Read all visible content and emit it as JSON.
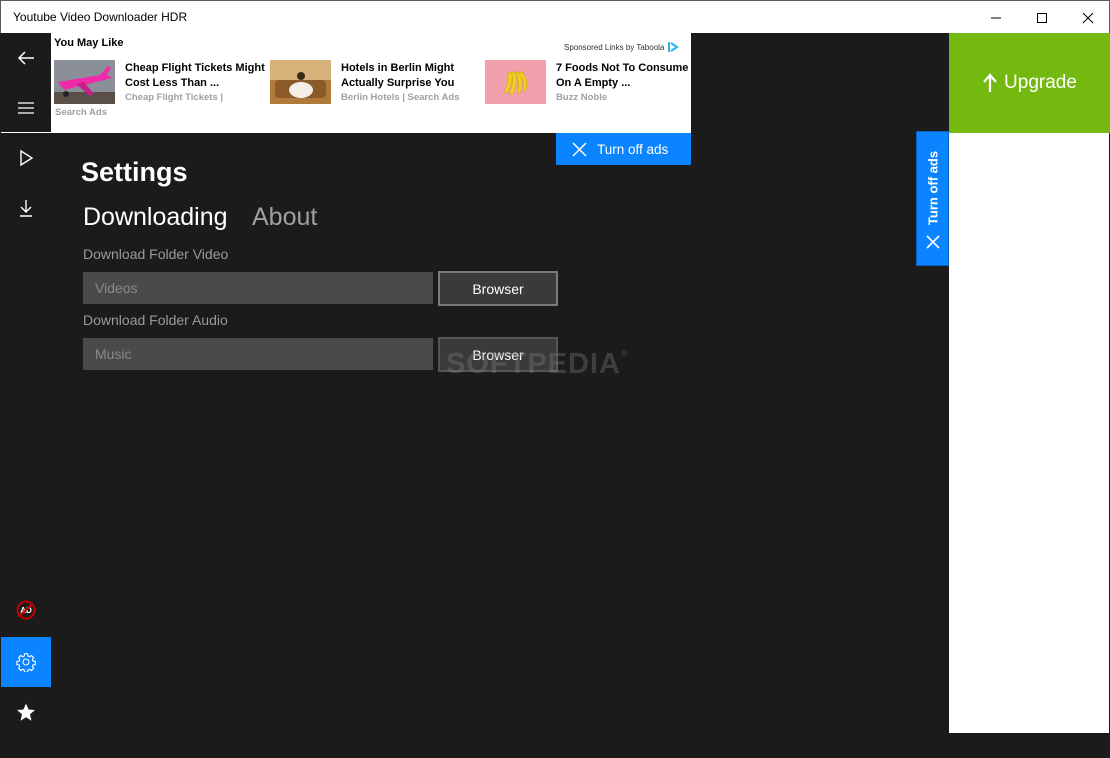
{
  "window": {
    "title": "Youtube Video Downloader HDR",
    "controls": [
      "minimize",
      "maximize",
      "close"
    ]
  },
  "nav": {
    "items": [
      {
        "name": "back",
        "icon": "arrow-left-icon"
      },
      {
        "name": "menu",
        "icon": "hamburger-icon"
      },
      {
        "name": "play",
        "icon": "play-icon"
      },
      {
        "name": "download",
        "icon": "download-icon"
      },
      {
        "name": "no-ads",
        "icon": "no-ads-icon"
      },
      {
        "name": "settings",
        "icon": "gear-icon",
        "active": true
      },
      {
        "name": "rate",
        "icon": "star-icon"
      }
    ]
  },
  "ad": {
    "heading": "You May Like",
    "sponsored": "Sponsored Links by Taboola",
    "items": [
      {
        "title": "Cheap Flight Tickets Might Cost Less Than ...",
        "source": "Cheap Flight Tickets |",
        "source2": "Search Ads"
      },
      {
        "title": "Hotels in Berlin Might Actually Surprise You",
        "source": "Berlin Hotels | Search Ads"
      },
      {
        "title": "7 Foods Not To Consume On A Empty ...",
        "source": "Buzz Noble"
      }
    ],
    "turn_off_label": "Turn off ads"
  },
  "settings": {
    "title": "Settings",
    "tabs": [
      {
        "label": "Downloading",
        "active": true
      },
      {
        "label": "About",
        "active": false
      }
    ],
    "video": {
      "label": "Download Folder Video",
      "value": "Videos",
      "button": "Browser"
    },
    "audio": {
      "label": "Download Folder Audio",
      "value": "Music",
      "button": "Browser"
    }
  },
  "watermark": "SOFTPEDIA",
  "upgrade": {
    "label": "Upgrade"
  },
  "side_ad": {
    "turn_off_label": "Turn off ads"
  },
  "colors": {
    "accent": "#0a84ff",
    "upgrade": "#73b90f",
    "background": "#1b1b1b"
  }
}
